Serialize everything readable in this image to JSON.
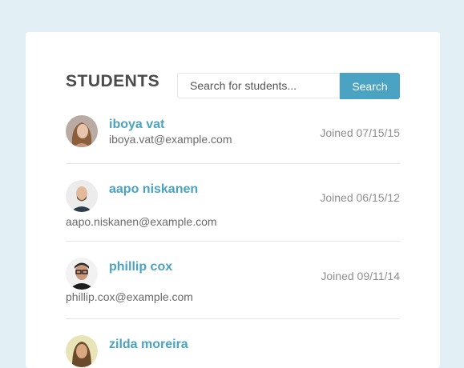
{
  "header": {
    "title": "STUDENTS"
  },
  "search": {
    "placeholder": "Search for students...",
    "button_label": "Search"
  },
  "students": [
    {
      "name": "iboya vat",
      "email": "iboya.vat@example.com",
      "joined": "Joined 07/15/15"
    },
    {
      "name": "aapo niskanen",
      "email": "aapo.niskanen@example.com",
      "joined": "Joined 06/15/12"
    },
    {
      "name": "phillip cox",
      "email": "phillip.cox@example.com",
      "joined": "Joined 09/11/14"
    },
    {
      "name": "zilda moreira",
      "email": "",
      "joined": ""
    }
  ],
  "colors": {
    "background": "#e2f0f6",
    "accent": "#4aa3c2",
    "title": "#4a4a4a"
  }
}
